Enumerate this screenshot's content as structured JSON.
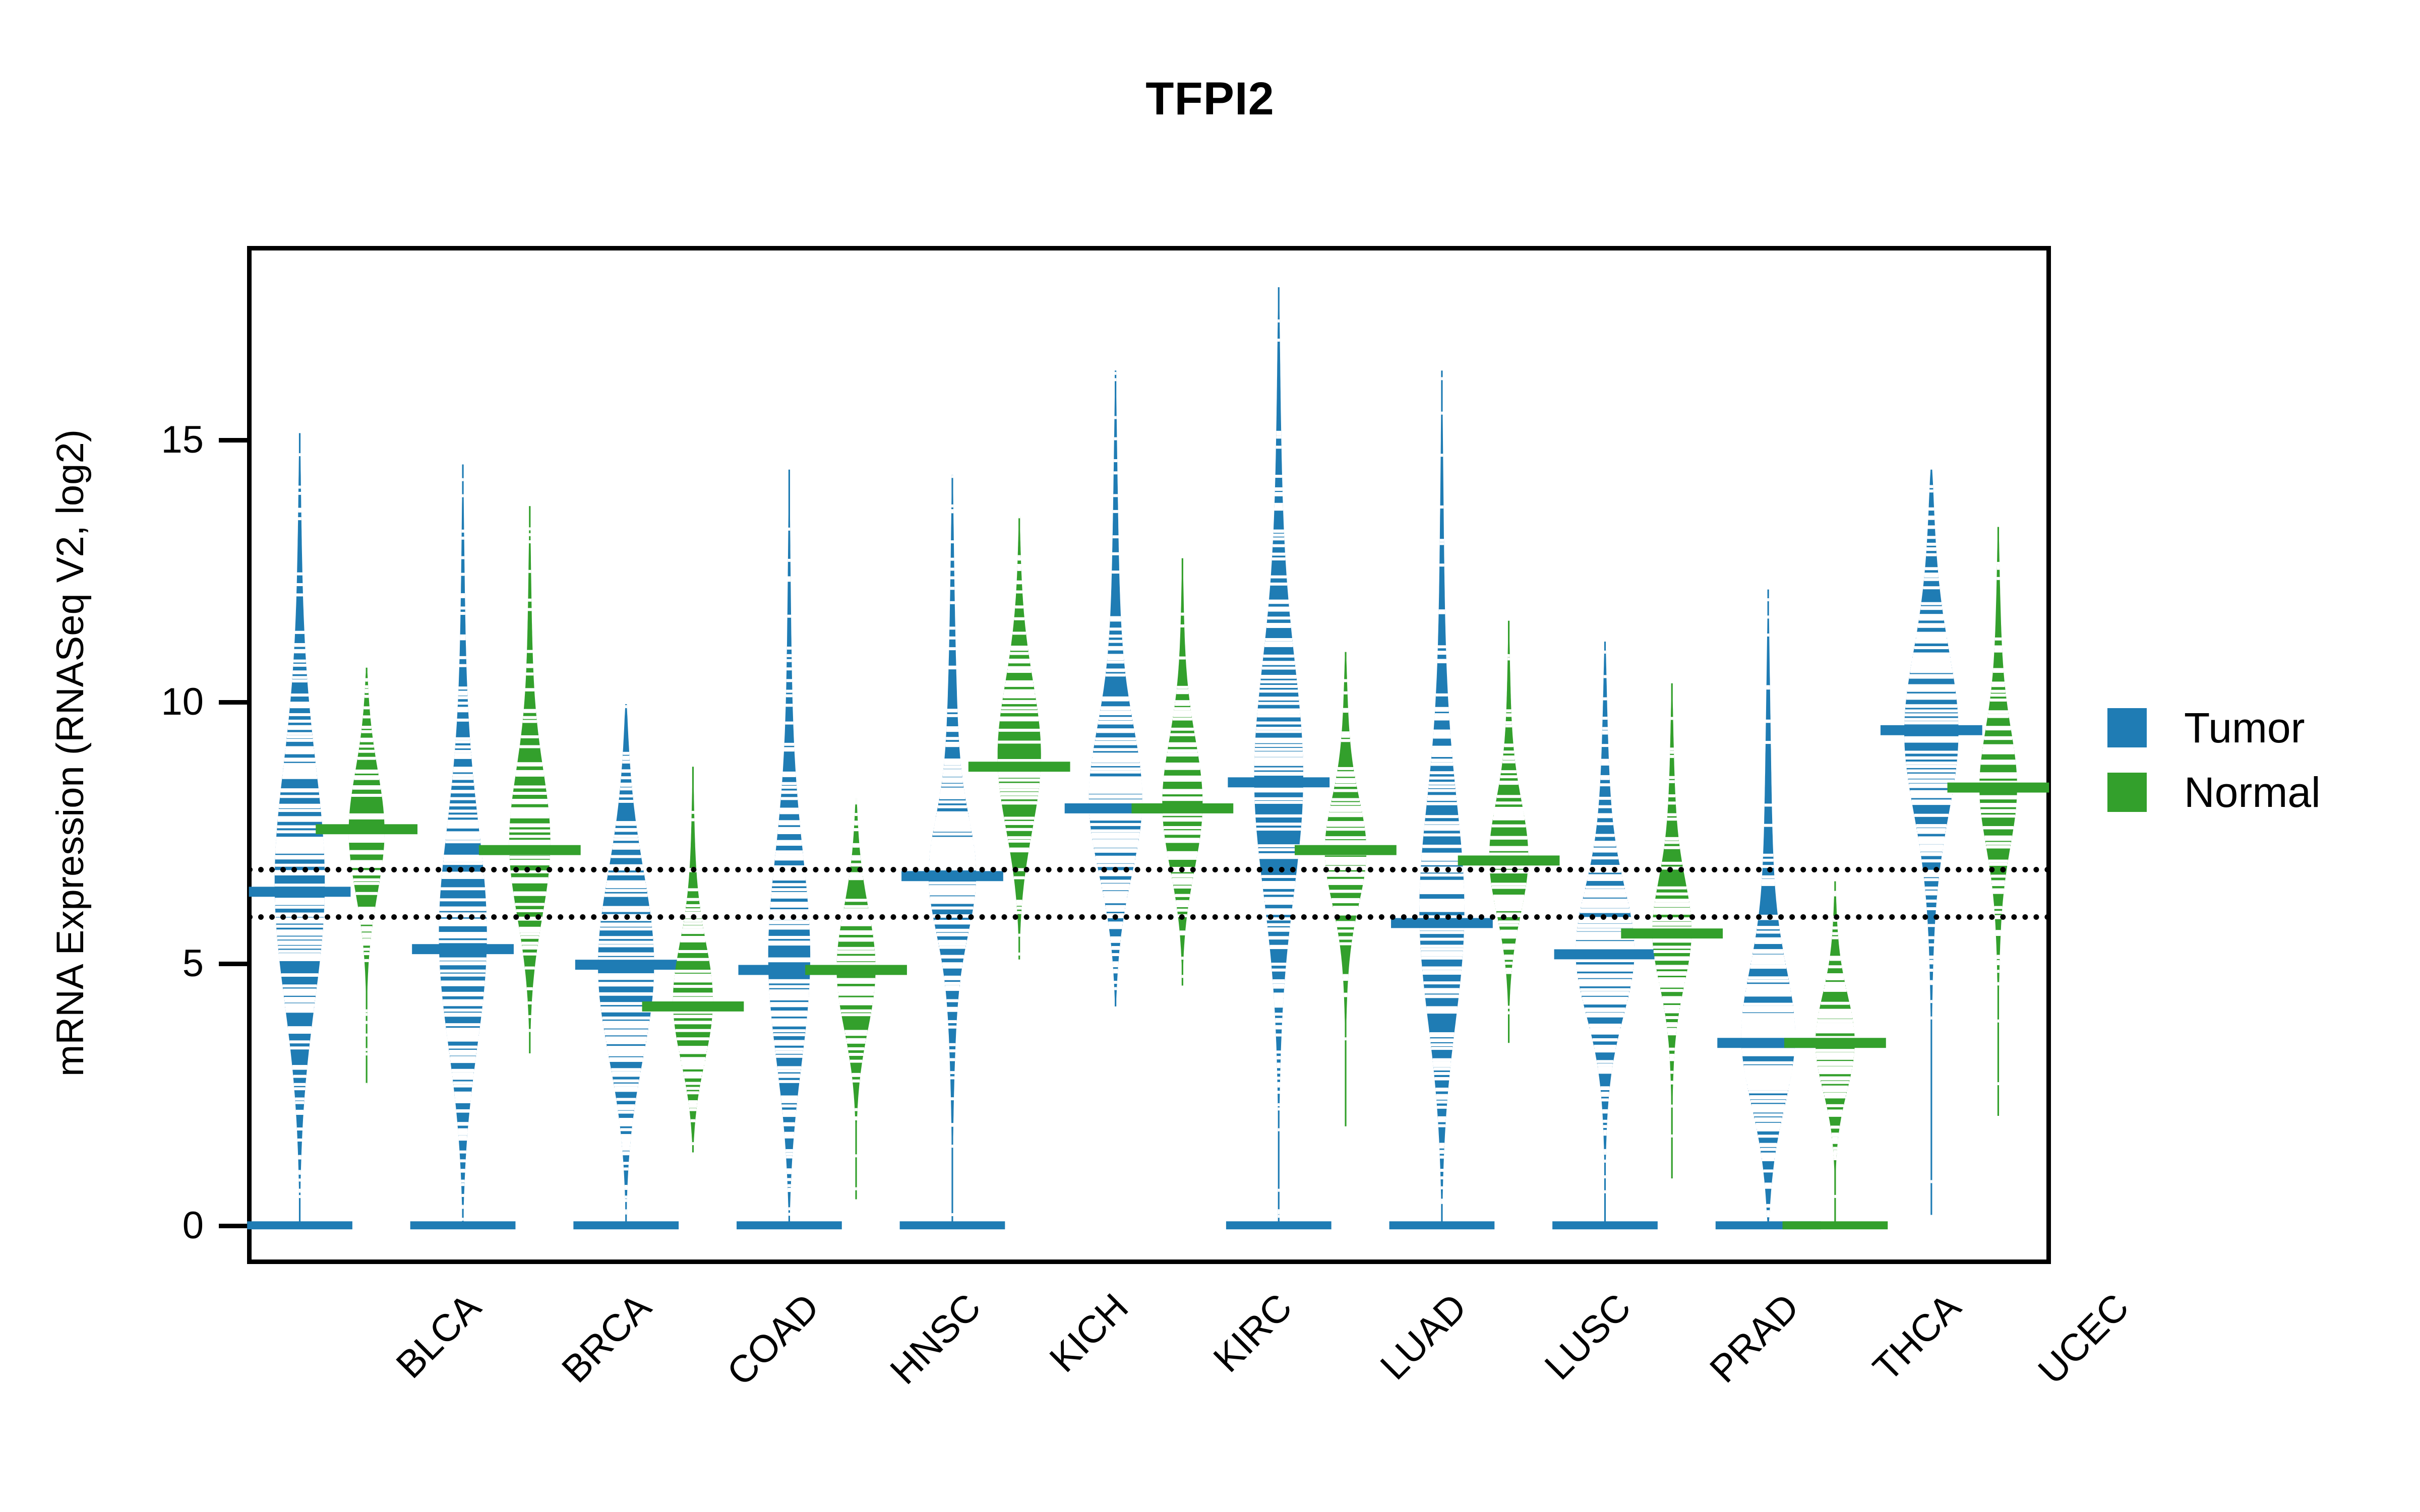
{
  "chart_data": {
    "type": "violin",
    "title": "TFPI2",
    "xlabel": "",
    "ylabel": "mRNA Expression (RNASeq V2, log2)",
    "ylim": [
      -0.9,
      18.7
    ],
    "y_ticks": [
      0,
      5,
      10,
      15
    ],
    "y_tick_labels": [
      "0",
      "5",
      "10",
      "15"
    ],
    "grid": false,
    "legend_position": "right",
    "reference_lines": [
      6.8,
      5.9
    ],
    "colors": {
      "tumor": "#1f7cb4",
      "normal": "#33a02c",
      "axis": "#000000",
      "background": "#ffffff"
    },
    "categories": [
      "BLCA",
      "BRCA",
      "COAD",
      "HNSC",
      "KICH",
      "KIRC",
      "LUAD",
      "LUSC",
      "PRAD",
      "THCA",
      "UCEC"
    ],
    "series": [
      {
        "name": "Tumor",
        "color": "#1f7cb4",
        "groups": [
          {
            "category": "BLCA",
            "median": 6.4,
            "min": 0.0,
            "max": 15.2,
            "q1": 4.3,
            "q3": 8.6,
            "width": 0.72
          },
          {
            "category": "BRCA",
            "median": 5.3,
            "min": 0.0,
            "max": 14.6,
            "q1": 3.6,
            "q3": 7.6,
            "width": 0.7
          },
          {
            "category": "COAD",
            "median": 5.0,
            "min": 0.0,
            "max": 10.0,
            "q1": 2.9,
            "q3": 6.6,
            "width": 0.8
          },
          {
            "category": "HNSC",
            "median": 4.9,
            "min": 0.0,
            "max": 14.5,
            "q1": 3.3,
            "q3": 7.0,
            "width": 0.62
          },
          {
            "category": "KICH",
            "median": 6.7,
            "min": 0.0,
            "max": 14.4,
            "q1": 5.6,
            "q3": 7.6,
            "width": 0.68
          },
          {
            "category": "KIRC",
            "median": 8.0,
            "min": 4.2,
            "max": 16.4,
            "q1": 6.9,
            "q3": 9.5,
            "width": 0.8
          },
          {
            "category": "LUAD",
            "median": 8.5,
            "min": 0.0,
            "max": 18.0,
            "q1": 6.6,
            "q3": 10.6,
            "width": 0.7
          },
          {
            "category": "LUSC",
            "median": 5.8,
            "min": 0.0,
            "max": 16.4,
            "q1": 4.1,
            "q3": 8.0,
            "width": 0.66
          },
          {
            "category": "PRAD",
            "median": 5.2,
            "min": 0.0,
            "max": 11.2,
            "q1": 4.2,
            "q3": 6.4,
            "width": 0.84
          },
          {
            "category": "THCA",
            "median": 3.5,
            "min": 0.0,
            "max": 12.2,
            "q1": 2.3,
            "q3": 4.7,
            "width": 0.82
          },
          {
            "category": "UCEC",
            "median": 9.5,
            "min": 0.2,
            "max": 14.5,
            "q1": 8.2,
            "q3": 11.0,
            "width": 0.8
          }
        ]
      },
      {
        "name": "Normal",
        "color": "#33a02c",
        "groups": [
          {
            "category": "BLCA",
            "median": 7.6,
            "min": 2.7,
            "max": 10.7,
            "q1": 6.4,
            "q3": 8.6,
            "width": 0.52
          },
          {
            "category": "BRCA",
            "median": 7.2,
            "min": 3.3,
            "max": 13.8,
            "q1": 6.0,
            "q3": 8.6,
            "width": 0.6
          },
          {
            "category": "COAD",
            "median": 4.2,
            "min": 1.4,
            "max": 8.8,
            "q1": 3.1,
            "q3": 5.3,
            "width": 0.58
          },
          {
            "category": "HNSC",
            "median": 4.9,
            "min": 0.5,
            "max": 8.2,
            "q1": 3.9,
            "q3": 6.1,
            "width": 0.56
          },
          {
            "category": "KICH",
            "median": 8.8,
            "min": 5.1,
            "max": 13.6,
            "q1": 7.8,
            "q3": 10.6,
            "width": 0.62
          },
          {
            "category": "KIRC",
            "median": 8.0,
            "min": 4.6,
            "max": 12.8,
            "q1": 6.8,
            "q3": 9.2,
            "width": 0.58
          },
          {
            "category": "LUAD",
            "median": 7.2,
            "min": 1.9,
            "max": 11.0,
            "q1": 6.2,
            "q3": 8.0,
            "width": 0.6
          },
          {
            "category": "LUSC",
            "median": 7.0,
            "min": 3.5,
            "max": 11.6,
            "q1": 6.0,
            "q3": 8.0,
            "width": 0.56
          },
          {
            "category": "PRAD",
            "median": 5.6,
            "min": 0.9,
            "max": 10.4,
            "q1": 4.8,
            "q3": 6.6,
            "width": 0.56
          },
          {
            "category": "THCA",
            "median": 3.5,
            "min": 0.0,
            "max": 6.6,
            "q1": 2.6,
            "q3": 4.3,
            "width": 0.56
          },
          {
            "category": "UCEC",
            "median": 8.4,
            "min": 2.1,
            "max": 13.4,
            "q1": 7.4,
            "q3": 9.4,
            "width": 0.54
          }
        ]
      }
    ],
    "legend": [
      {
        "label": "Tumor",
        "color": "#1f7cb4"
      },
      {
        "label": "Normal",
        "color": "#33a02c"
      }
    ]
  }
}
